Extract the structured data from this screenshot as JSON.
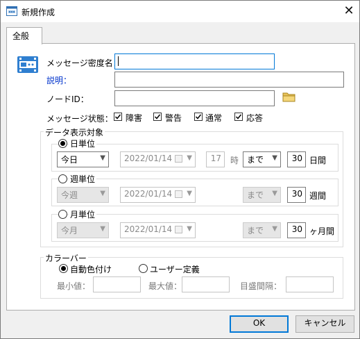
{
  "window": {
    "title": "新規作成",
    "close_icon": "close-icon"
  },
  "tab": {
    "label": "全般"
  },
  "form": {
    "name_label": "メッセージ密度名：",
    "name_value": "",
    "description_label": "説明：",
    "description_value": "",
    "node_label": "ノードID：",
    "node_value": "",
    "state_label": "メッセージ状態：",
    "states": [
      {
        "label": "障害",
        "checked": true
      },
      {
        "label": "警告",
        "checked": true
      },
      {
        "label": "通常",
        "checked": true
      },
      {
        "label": "応答",
        "checked": true
      }
    ]
  },
  "data_target": {
    "title": "データ表示対象",
    "day": {
      "label": "日単位",
      "selected": true,
      "period": "今日",
      "date": "2022/01/14",
      "hour": "17",
      "hour_unit": "時",
      "until": "まで",
      "count": "30",
      "count_unit": "日間"
    },
    "week": {
      "label": "週単位",
      "selected": false,
      "period": "今週",
      "date": "2022/01/14",
      "until": "まで",
      "count": "30",
      "count_unit": "週間"
    },
    "month": {
      "label": "月単位",
      "selected": false,
      "period": "今月",
      "date": "2022/01/14",
      "until": "まで",
      "count": "30",
      "count_unit": "ヶ月間"
    }
  },
  "color_bar": {
    "title": "カラーバー",
    "auto_label": "自動色付け",
    "auto_selected": true,
    "user_label": "ユーザー定義",
    "user_selected": false,
    "min_label": "最小値：",
    "min_value": "",
    "max_label": "最大値：",
    "max_value": "",
    "step_label": "目盛間隔：",
    "step_value": ""
  },
  "buttons": {
    "ok": "OK",
    "cancel": "キャンセル"
  },
  "colors": {
    "accent": "#0078d7",
    "link": "#0033cc"
  }
}
